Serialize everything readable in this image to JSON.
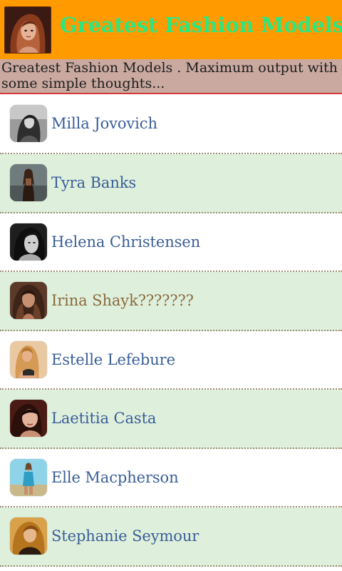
{
  "header": {
    "title": "Greatest Fashion Models",
    "logo_icon": "model-portrait-logo"
  },
  "subtitle": {
    "text": "Greatest Fashion Models . Maximum output with some simple thoughts..."
  },
  "colors": {
    "header_bg": "#ff9a00",
    "title_text": "#2ee57f",
    "subtitle_bg": "#c9a9a0",
    "subtitle_border": "#d63a3a",
    "row_alt_bg": "#deefdc",
    "link_text": "#3a5e97",
    "visited_link_text": "#8a6a3c"
  },
  "models": [
    {
      "name": "Milla Jovovich",
      "thumb_icon": "milla-jovovich-photo"
    },
    {
      "name": "Tyra Banks",
      "thumb_icon": "tyra-banks-photo"
    },
    {
      "name": "Helena Christensen",
      "thumb_icon": "helena-christensen-photo"
    },
    {
      "name": "Irina Shayk???????",
      "thumb_icon": "irina-shayk-photo",
      "visited": true
    },
    {
      "name": "Estelle Lefebure",
      "thumb_icon": "estelle-lefebure-photo"
    },
    {
      "name": "Laetitia Casta",
      "thumb_icon": "laetitia-casta-photo"
    },
    {
      "name": "Elle Macpherson",
      "thumb_icon": "elle-macpherson-photo"
    },
    {
      "name": "Stephanie Seymour",
      "thumb_icon": "stephanie-seymour-photo"
    }
  ]
}
